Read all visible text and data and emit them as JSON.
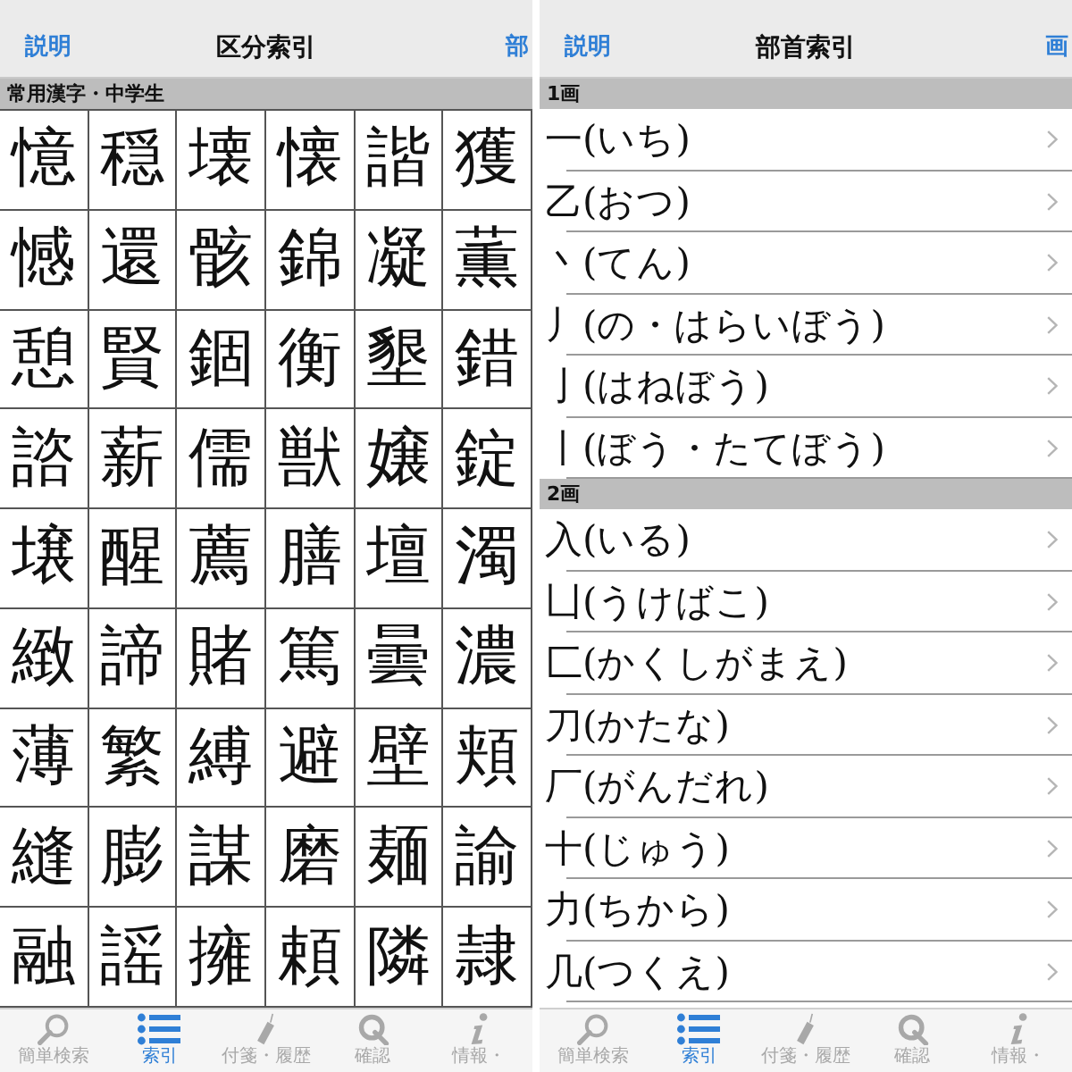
{
  "left_screen": {
    "nav_bar": {
      "left_button": "説明",
      "title": "区分索引",
      "right_button": "部"
    },
    "section_header": "常用漢字・中学生",
    "kanji_grid": [
      [
        "憶",
        "穏",
        "壊",
        "懐",
        "諧",
        "獲"
      ],
      [
        "憾",
        "還",
        "骸",
        "錦",
        "凝",
        "薫"
      ],
      [
        "憩",
        "賢",
        "錮",
        "衡",
        "墾",
        "錯"
      ],
      [
        "諮",
        "薪",
        "儒",
        "獣",
        "嬢",
        "錠"
      ],
      [
        "壌",
        "醒",
        "薦",
        "膳",
        "壇",
        "濁"
      ],
      [
        "緻",
        "諦",
        "賭",
        "篤",
        "曇",
        "濃"
      ],
      [
        "薄",
        "繁",
        "縛",
        "避",
        "壁",
        "頬"
      ],
      [
        "縫",
        "膨",
        "謀",
        "磨",
        "麺",
        "諭"
      ],
      [
        "融",
        "謡",
        "擁",
        "頼",
        "隣",
        "隷"
      ]
    ],
    "tab_bar": [
      {
        "kind": "search",
        "label": "簡単検索",
        "selected": false
      },
      {
        "kind": "list",
        "label": "索引",
        "selected": true
      },
      {
        "kind": "tag",
        "label": "付箋・履歴",
        "selected": false
      },
      {
        "kind": "q",
        "label": "確認",
        "selected": false
      },
      {
        "kind": "info",
        "label": "情報・",
        "selected": false
      }
    ]
  },
  "right_screen": {
    "nav_bar": {
      "left_button": "説明",
      "title": "部首索引",
      "right_button": "画"
    },
    "sections": [
      {
        "header": "1画",
        "items": [
          "一(いち)",
          "乙(おつ)",
          "丶(てん)",
          "丿(の・はらいぼう)",
          "亅(はねぼう)",
          "丨(ぼう・たてぼう)"
        ]
      },
      {
        "header": "2画",
        "items": [
          "入(いる)",
          "凵(うけばこ)",
          "匚(かくしがまえ)",
          "刀(かたな)",
          "厂(がんだれ)",
          "十(じゅう)",
          "力(ちから)",
          "几(つくえ)"
        ]
      }
    ],
    "tab_bar": [
      {
        "kind": "search",
        "label": "簡単検索",
        "selected": false
      },
      {
        "kind": "list",
        "label": "索引",
        "selected": true
      },
      {
        "kind": "tag",
        "label": "付箋・履歴",
        "selected": false
      },
      {
        "kind": "q",
        "label": "確認",
        "selected": false
      },
      {
        "kind": "info",
        "label": "情報・",
        "selected": false
      }
    ]
  }
}
